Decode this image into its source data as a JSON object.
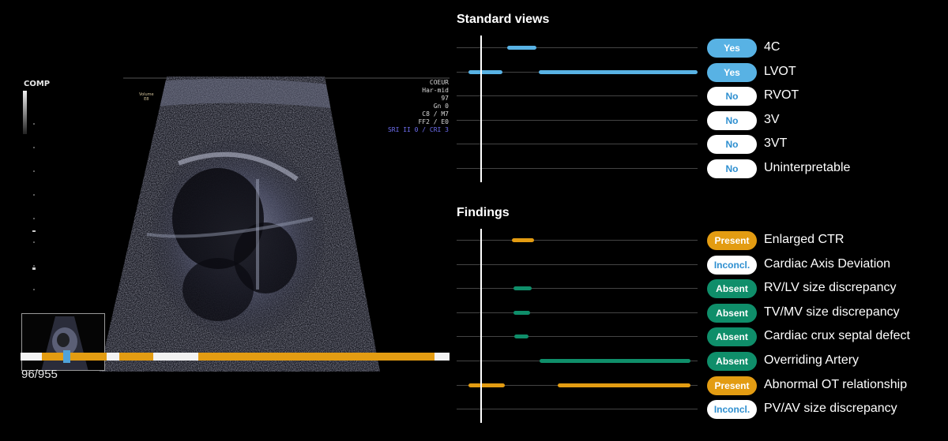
{
  "ultrasound": {
    "logo": "COMP",
    "overlay": [
      "COEUR",
      "Har-mid",
      "97",
      "Gn  0",
      "C8 / M7",
      "FF2 / E0"
    ],
    "overlay_highlight": "SRI II 0 / CRI 3",
    "volume_label": [
      "Volume",
      "E8"
    ],
    "frame_counter": "96/955",
    "frame_position": 0.1
  },
  "standard_views": {
    "title": "Standard views",
    "rows": [
      {
        "label": "4C",
        "status": "Yes",
        "style": "blue",
        "bars": [
          [
            0.21,
            0.33
          ]
        ]
      },
      {
        "label": "LVOT",
        "status": "Yes",
        "style": "blue",
        "bars": [
          [
            0.05,
            0.19
          ],
          [
            0.34,
            1.0
          ]
        ]
      },
      {
        "label": "RVOT",
        "status": "No",
        "style": "white",
        "bars": []
      },
      {
        "label": "3V",
        "status": "No",
        "style": "white",
        "bars": []
      },
      {
        "label": "3VT",
        "status": "No",
        "style": "white",
        "bars": []
      },
      {
        "label": "Uninterpretable",
        "status": "No",
        "style": "white",
        "bars": []
      }
    ]
  },
  "findings": {
    "title": "Findings",
    "rows": [
      {
        "label": "Enlarged CTR",
        "status": "Present",
        "style": "orange",
        "bars": [
          [
            0.23,
            0.32
          ]
        ]
      },
      {
        "label": "Cardiac Axis Deviation",
        "status": "Inconcl.",
        "style": "white",
        "bars": []
      },
      {
        "label": "RV/LV size discrepancy",
        "status": "Absent",
        "style": "green",
        "bars": [
          [
            0.235,
            0.31
          ]
        ]
      },
      {
        "label": "TV/MV size discrepancy",
        "status": "Absent",
        "style": "green",
        "bars": [
          [
            0.235,
            0.305
          ]
        ]
      },
      {
        "label": "Cardiac crux septal defect",
        "status": "Absent",
        "style": "green",
        "bars": [
          [
            0.24,
            0.3
          ]
        ]
      },
      {
        "label": "Overriding Artery",
        "status": "Absent",
        "style": "green",
        "bars": [
          [
            0.345,
            0.97
          ]
        ]
      },
      {
        "label": "Abnormal OT relationship",
        "status": "Present",
        "style": "orange",
        "bars": [
          [
            0.05,
            0.2
          ],
          [
            0.42,
            0.97
          ]
        ]
      },
      {
        "label": "PV/AV size discrepancy",
        "status": "Inconcl.",
        "style": "white",
        "bars": []
      }
    ]
  },
  "colors": {
    "blue": "#58b2e4",
    "orange": "#e39c12",
    "green": "#0f8e6a",
    "timeline_orange": "#e39c12",
    "timeline_white": "#f2f2f2"
  },
  "timeline_segments": [
    {
      "color": "white",
      "from": 0.0,
      "to": 0.05
    },
    {
      "color": "orange",
      "from": 0.05,
      "to": 0.2
    },
    {
      "color": "white",
      "from": 0.2,
      "to": 0.23
    },
    {
      "color": "orange",
      "from": 0.23,
      "to": 0.31
    },
    {
      "color": "white",
      "from": 0.31,
      "to": 0.415
    },
    {
      "color": "orange",
      "from": 0.415,
      "to": 0.965
    },
    {
      "color": "white",
      "from": 0.965,
      "to": 1.0
    }
  ]
}
